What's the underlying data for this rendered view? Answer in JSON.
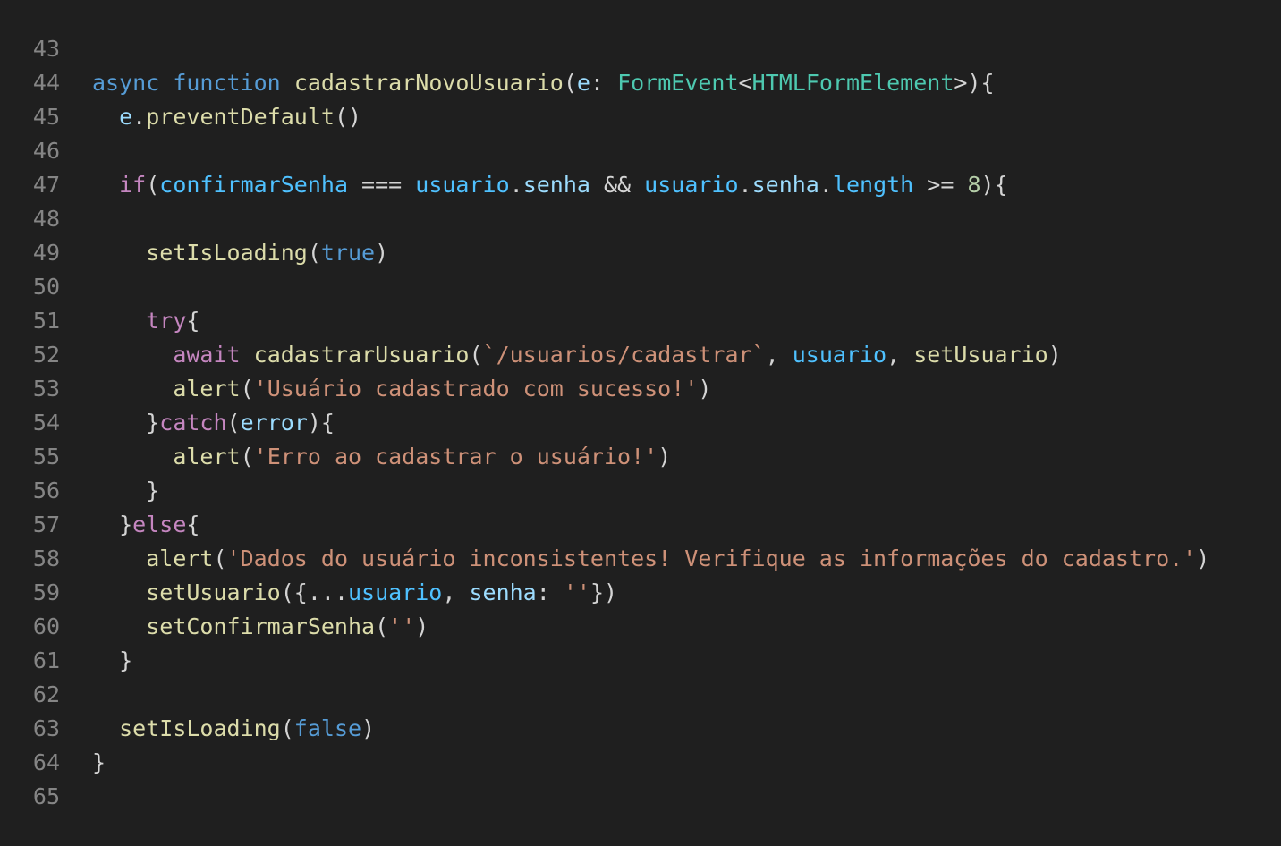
{
  "editor": {
    "colors": {
      "background": "#1f1f1f",
      "line_number": "#858585",
      "default": "#d4d4d4",
      "keyword_blue": "#569cd6",
      "control_purple": "#c586c0",
      "function_yellow": "#dcdcaa",
      "variable_lightblue": "#9cdcfe",
      "constant_blue": "#4fc1ff",
      "type_teal": "#4ec9b0",
      "string_orange": "#ce9178",
      "number_green": "#b5cea8"
    },
    "lines": [
      {
        "number": "43",
        "tokens": []
      },
      {
        "number": "44",
        "tokens": [
          {
            "text": "async",
            "color": "#569cd6"
          },
          {
            "text": " ",
            "color": "#d4d4d4"
          },
          {
            "text": "function",
            "color": "#569cd6"
          },
          {
            "text": " ",
            "color": "#d4d4d4"
          },
          {
            "text": "cadastrarNovoUsuario",
            "color": "#dcdcaa"
          },
          {
            "text": "(",
            "color": "#d4d4d4"
          },
          {
            "text": "e",
            "color": "#9cdcfe"
          },
          {
            "text": ": ",
            "color": "#d4d4d4"
          },
          {
            "text": "FormEvent",
            "color": "#4ec9b0"
          },
          {
            "text": "<",
            "color": "#d4d4d4"
          },
          {
            "text": "HTMLFormElement",
            "color": "#4ec9b0"
          },
          {
            "text": ">){",
            "color": "#d4d4d4"
          }
        ]
      },
      {
        "number": "45",
        "tokens": [
          {
            "text": "  ",
            "color": "#d4d4d4"
          },
          {
            "text": "e",
            "color": "#9cdcfe"
          },
          {
            "text": ".",
            "color": "#d4d4d4"
          },
          {
            "text": "preventDefault",
            "color": "#dcdcaa"
          },
          {
            "text": "()",
            "color": "#d4d4d4"
          }
        ]
      },
      {
        "number": "46",
        "tokens": []
      },
      {
        "number": "47",
        "tokens": [
          {
            "text": "  ",
            "color": "#d4d4d4"
          },
          {
            "text": "if",
            "color": "#c586c0"
          },
          {
            "text": "(",
            "color": "#d4d4d4"
          },
          {
            "text": "confirmarSenha",
            "color": "#4fc1ff"
          },
          {
            "text": " === ",
            "color": "#d4d4d4"
          },
          {
            "text": "usuario",
            "color": "#4fc1ff"
          },
          {
            "text": ".",
            "color": "#d4d4d4"
          },
          {
            "text": "senha",
            "color": "#9cdcfe"
          },
          {
            "text": " && ",
            "color": "#d4d4d4"
          },
          {
            "text": "usuario",
            "color": "#4fc1ff"
          },
          {
            "text": ".",
            "color": "#d4d4d4"
          },
          {
            "text": "senha",
            "color": "#9cdcfe"
          },
          {
            "text": ".",
            "color": "#d4d4d4"
          },
          {
            "text": "length",
            "color": "#4fc1ff"
          },
          {
            "text": " >= ",
            "color": "#d4d4d4"
          },
          {
            "text": "8",
            "color": "#b5cea8"
          },
          {
            "text": "){",
            "color": "#d4d4d4"
          }
        ]
      },
      {
        "number": "48",
        "tokens": []
      },
      {
        "number": "49",
        "tokens": [
          {
            "text": "    ",
            "color": "#d4d4d4"
          },
          {
            "text": "setIsLoading",
            "color": "#dcdcaa"
          },
          {
            "text": "(",
            "color": "#d4d4d4"
          },
          {
            "text": "true",
            "color": "#569cd6"
          },
          {
            "text": ")",
            "color": "#d4d4d4"
          }
        ]
      },
      {
        "number": "50",
        "tokens": []
      },
      {
        "number": "51",
        "tokens": [
          {
            "text": "    ",
            "color": "#d4d4d4"
          },
          {
            "text": "try",
            "color": "#c586c0"
          },
          {
            "text": "{",
            "color": "#d4d4d4"
          }
        ]
      },
      {
        "number": "52",
        "tokens": [
          {
            "text": "      ",
            "color": "#d4d4d4"
          },
          {
            "text": "await",
            "color": "#c586c0"
          },
          {
            "text": " ",
            "color": "#d4d4d4"
          },
          {
            "text": "cadastrarUsuario",
            "color": "#dcdcaa"
          },
          {
            "text": "(",
            "color": "#d4d4d4"
          },
          {
            "text": "`/usuarios/cadastrar`",
            "color": "#ce9178"
          },
          {
            "text": ", ",
            "color": "#d4d4d4"
          },
          {
            "text": "usuario",
            "color": "#4fc1ff"
          },
          {
            "text": ", ",
            "color": "#d4d4d4"
          },
          {
            "text": "setUsuario",
            "color": "#dcdcaa"
          },
          {
            "text": ")",
            "color": "#d4d4d4"
          }
        ]
      },
      {
        "number": "53",
        "tokens": [
          {
            "text": "      ",
            "color": "#d4d4d4"
          },
          {
            "text": "alert",
            "color": "#dcdcaa"
          },
          {
            "text": "(",
            "color": "#d4d4d4"
          },
          {
            "text": "'Usuário cadastrado com sucesso!'",
            "color": "#ce9178"
          },
          {
            "text": ")",
            "color": "#d4d4d4"
          }
        ]
      },
      {
        "number": "54",
        "tokens": [
          {
            "text": "    ",
            "color": "#d4d4d4"
          },
          {
            "text": "}",
            "color": "#d4d4d4"
          },
          {
            "text": "catch",
            "color": "#c586c0"
          },
          {
            "text": "(",
            "color": "#d4d4d4"
          },
          {
            "text": "error",
            "color": "#9cdcfe"
          },
          {
            "text": "){",
            "color": "#d4d4d4"
          }
        ]
      },
      {
        "number": "55",
        "tokens": [
          {
            "text": "      ",
            "color": "#d4d4d4"
          },
          {
            "text": "alert",
            "color": "#dcdcaa"
          },
          {
            "text": "(",
            "color": "#d4d4d4"
          },
          {
            "text": "'Erro ao cadastrar o usuário!'",
            "color": "#ce9178"
          },
          {
            "text": ")",
            "color": "#d4d4d4"
          }
        ]
      },
      {
        "number": "56",
        "tokens": [
          {
            "text": "    ",
            "color": "#d4d4d4"
          },
          {
            "text": "}",
            "color": "#d4d4d4"
          }
        ]
      },
      {
        "number": "57",
        "tokens": [
          {
            "text": "  ",
            "color": "#d4d4d4"
          },
          {
            "text": "}",
            "color": "#d4d4d4"
          },
          {
            "text": "else",
            "color": "#c586c0"
          },
          {
            "text": "{",
            "color": "#d4d4d4"
          }
        ]
      },
      {
        "number": "58",
        "tokens": [
          {
            "text": "    ",
            "color": "#d4d4d4"
          },
          {
            "text": "alert",
            "color": "#dcdcaa"
          },
          {
            "text": "(",
            "color": "#d4d4d4"
          },
          {
            "text": "'Dados do usuário inconsistentes! Verifique as informações do cadastro.'",
            "color": "#ce9178"
          },
          {
            "text": ")",
            "color": "#d4d4d4"
          }
        ]
      },
      {
        "number": "59",
        "tokens": [
          {
            "text": "    ",
            "color": "#d4d4d4"
          },
          {
            "text": "setUsuario",
            "color": "#dcdcaa"
          },
          {
            "text": "({...",
            "color": "#d4d4d4"
          },
          {
            "text": "usuario",
            "color": "#4fc1ff"
          },
          {
            "text": ", ",
            "color": "#d4d4d4"
          },
          {
            "text": "senha",
            "color": "#9cdcfe"
          },
          {
            "text": ": ",
            "color": "#d4d4d4"
          },
          {
            "text": "''",
            "color": "#ce9178"
          },
          {
            "text": "})",
            "color": "#d4d4d4"
          }
        ]
      },
      {
        "number": "60",
        "tokens": [
          {
            "text": "    ",
            "color": "#d4d4d4"
          },
          {
            "text": "setConfirmarSenha",
            "color": "#dcdcaa"
          },
          {
            "text": "(",
            "color": "#d4d4d4"
          },
          {
            "text": "''",
            "color": "#ce9178"
          },
          {
            "text": ")",
            "color": "#d4d4d4"
          }
        ]
      },
      {
        "number": "61",
        "tokens": [
          {
            "text": "  ",
            "color": "#d4d4d4"
          },
          {
            "text": "}",
            "color": "#d4d4d4"
          }
        ]
      },
      {
        "number": "62",
        "tokens": []
      },
      {
        "number": "63",
        "tokens": [
          {
            "text": "  ",
            "color": "#d4d4d4"
          },
          {
            "text": "setIsLoading",
            "color": "#dcdcaa"
          },
          {
            "text": "(",
            "color": "#d4d4d4"
          },
          {
            "text": "false",
            "color": "#569cd6"
          },
          {
            "text": ")",
            "color": "#d4d4d4"
          }
        ]
      },
      {
        "number": "64",
        "tokens": [
          {
            "text": "}",
            "color": "#d4d4d4"
          }
        ]
      },
      {
        "number": "65",
        "tokens": []
      }
    ]
  }
}
